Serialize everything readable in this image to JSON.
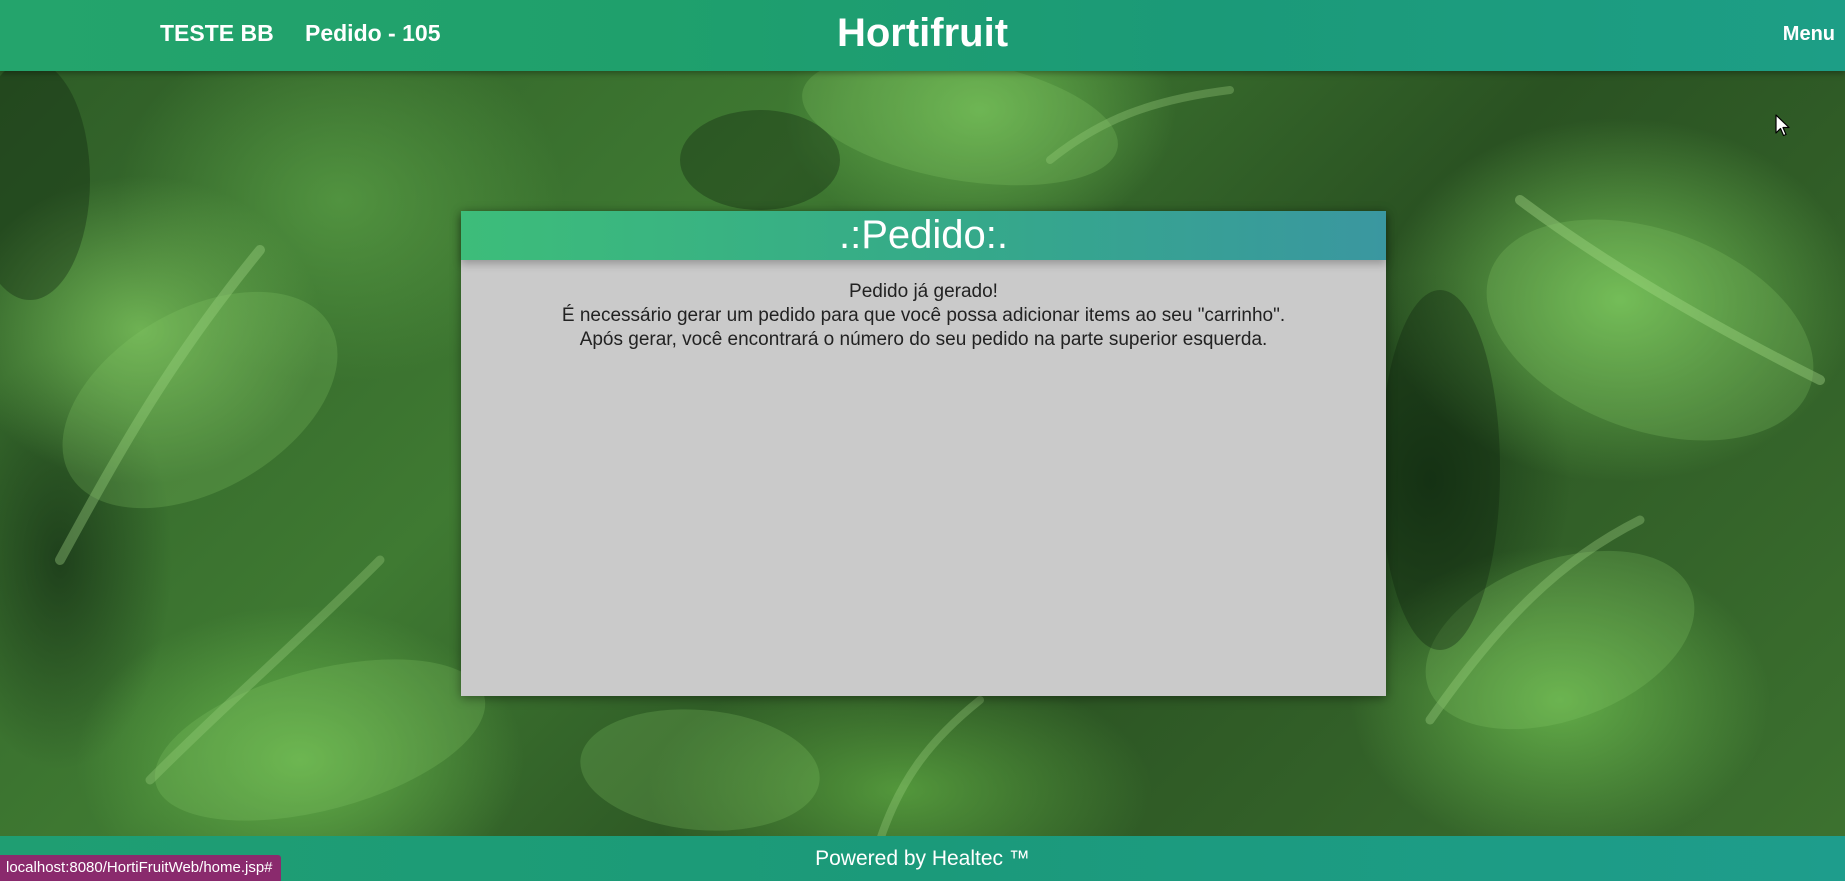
{
  "header": {
    "user_name": "TESTE BB",
    "order_label": "Pedido - 105",
    "brand": "Hortifruit",
    "menu_label": "Menu"
  },
  "card": {
    "title": ".:Pedido:.",
    "lines": [
      "Pedido já gerado!",
      "É necessário gerar um pedido para que você possa adicionar items ao seu \"carrinho\".",
      "Após gerar, você encontrará o número do seu pedido na parte superior esquerda."
    ]
  },
  "footer": {
    "powered_by": "Powered by Healtec ™"
  },
  "status_bar": {
    "url": "localhost:8080/HortiFruitWeb/home.jsp#"
  },
  "colors": {
    "header_bg": "#1fa06c",
    "card_bg": "#cacaca",
    "card_title_bg": "#35a98a",
    "footer_bg": "#1b9a7a",
    "status_url_bg": "#8a2a6d"
  }
}
